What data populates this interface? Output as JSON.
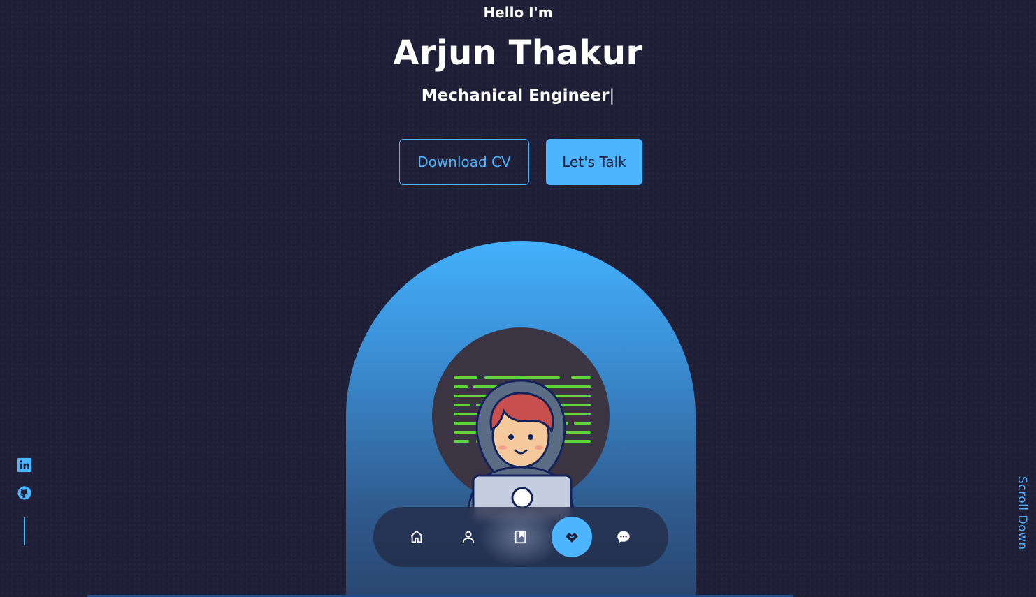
{
  "header": {
    "greeting": "Hello I'm",
    "name": "Arjun Thakur",
    "role": "Mechanical Engineer",
    "caret": "|"
  },
  "cta": {
    "download_label": "Download CV",
    "talk_label": "Let's Talk"
  },
  "scroll": {
    "label": "Scroll Down"
  },
  "socials": [
    {
      "icon": "linkedin-icon"
    },
    {
      "icon": "github-icon"
    }
  ],
  "nav": {
    "items": [
      {
        "icon": "home-icon",
        "active": false
      },
      {
        "icon": "user-icon",
        "active": false
      },
      {
        "icon": "book-icon",
        "active": false
      },
      {
        "icon": "handshake-icon",
        "active": true
      },
      {
        "icon": "chat-icon",
        "active": false
      }
    ]
  },
  "colors": {
    "background": "#1f1f38",
    "accent": "#4db5ff",
    "text": "#ffffff"
  }
}
